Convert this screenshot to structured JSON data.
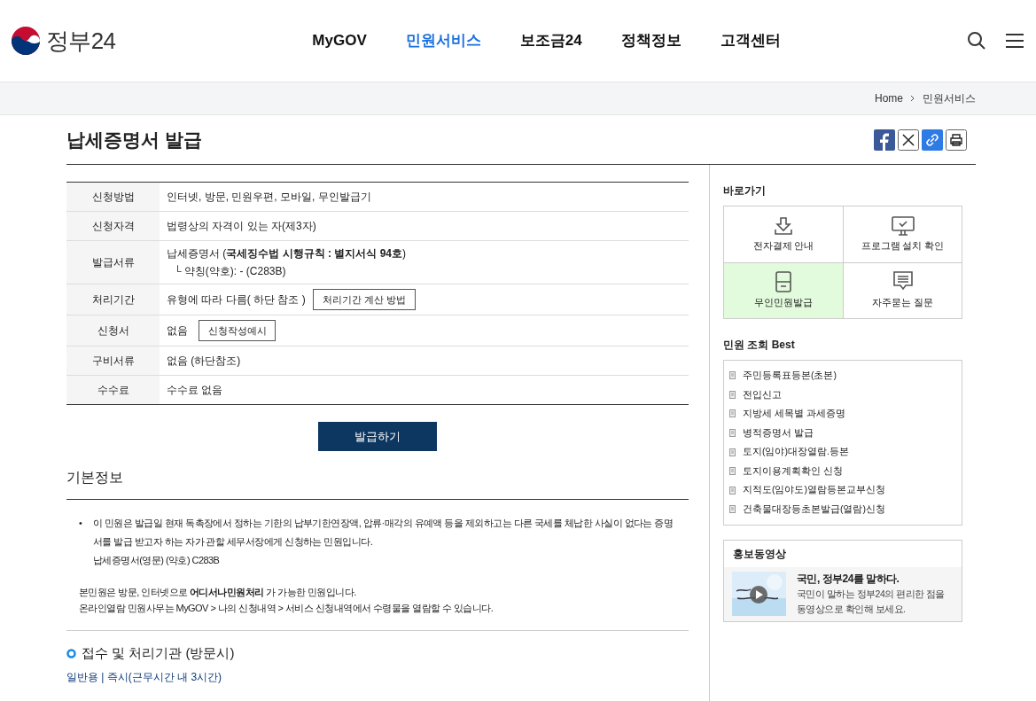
{
  "header": {
    "logo": "정부24",
    "nav": [
      {
        "label": "MyGOV",
        "selected": false
      },
      {
        "label": "민원서비스",
        "selected": true
      },
      {
        "label": "보조금24",
        "selected": false
      },
      {
        "label": "정책정보",
        "selected": false
      },
      {
        "label": "고객센터",
        "selected": false
      }
    ]
  },
  "breadcrumb": [
    "Home",
    "민원서비스"
  ],
  "page_title": "납세증명서 발급",
  "info_table": [
    {
      "label": "신청방법",
      "value": "인터넷, 방문, 민원우편, 모바일, 무인발급기"
    },
    {
      "label": "신청자격",
      "value": "법령상의 자격이 있는 자(제3자)"
    },
    {
      "label": "발급서류",
      "value": "납세증명서 (**국세징수법 시행규칙 : 별지서식 94호**)",
      "sub": "└ 약칭(약호): - (C283B)"
    },
    {
      "label": "처리기간",
      "value": "유형에 따라 다름( 하단 참조 )",
      "button": "처리기간 계산 방법"
    },
    {
      "label": "신청서",
      "value": "없음",
      "button": "신청작성예시"
    },
    {
      "label": "구비서류",
      "value": "없음 (하단참조)"
    },
    {
      "label": "수수료",
      "value": "수수료 없음"
    }
  ],
  "issue_button": "발급하기",
  "basic_info": {
    "heading": "기본정보",
    "bullet_mark": "•",
    "bullet": "이 민원은 발급일 현재 독촉장에서 정하는 기한의 납부기한연장액, 압류·매각의 유예액 등을 제외하고는 다른 국세를 체납한 사실이 없다는 증명서를 발급 받고자 하는 자가 관할 세무서장에게 신청하는 민원입니다.",
    "bullet_sub": "납세증명서(영문) (약호) C283B",
    "notes": [
      "본민원은 방문, 인터넷으로 **어디서나민원처리** 가 가능한 민원입니다.",
      "온라인열람 민원사무는 MyGOV > 나의 신청내역 > 서비스 신청내역에서 수령물을 열람할 수 있습니다."
    ]
  },
  "agency": {
    "heading": "접수 및 처리기관 (방문시)",
    "detail": "일반용 | 즉시(근무시간 내 3시간)"
  },
  "shortcuts": {
    "title": "바로가기",
    "items": [
      {
        "label": "전자결제 안내",
        "selected": false
      },
      {
        "label": "프로그램 설치 확인",
        "selected": false
      },
      {
        "label": "무인민원발급",
        "selected": true
      },
      {
        "label": "자주묻는 질문",
        "selected": false
      }
    ]
  },
  "best": {
    "title": "민원 조회 Best",
    "items": [
      "주민등록표등본(초본)",
      "전입신고",
      "지방세 세목별 과세증명",
      "병적증명서 발급",
      "토지(임야)대장열람.등본",
      "토지이용계획확인 신청",
      "지적도(임야도)열람등본교부신청",
      "건축물대장등초본발급(열람)신청"
    ]
  },
  "video": {
    "title": "홍보동영상",
    "headline": "국민, 정부24를 말하다.",
    "description": [
      "국민이 말하는 정부24의 편리한 점을",
      "동영상으로 확인해 보세요."
    ]
  }
}
